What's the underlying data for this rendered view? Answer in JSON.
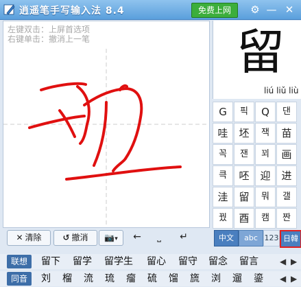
{
  "titlebar": {
    "title": "逍遥笔手写输入法 8.4",
    "online_button": "免费上网",
    "settings_icon": "gear-icon",
    "minimize_icon": "minimize-icon",
    "close_icon": "close-icon"
  },
  "pad": {
    "hint_line1": "左键双击：上屏首选项",
    "hint_line2": "右键单击：撤消上一笔",
    "stroke_color": "#e01010"
  },
  "padbar": {
    "clear_label": "清除",
    "undo_label": "撤消",
    "camera_icon": "camera-icon",
    "left_icon": "arrow-left-icon",
    "space_icon": "space-icon",
    "enter_icon": "enter-icon"
  },
  "preview": {
    "character": "留",
    "pinyin": "liú liǔ liù"
  },
  "grid_cells": [
    [
      "G",
      "픽",
      "Q",
      "댄"
    ],
    [
      "哇",
      "坯",
      "잭",
      "苗"
    ],
    [
      "꼭",
      "잰",
      "꾀",
      "画"
    ],
    [
      "큭",
      "呸",
      "迎",
      "进"
    ],
    [
      "洼",
      "留",
      "뭐",
      "갤"
    ],
    [
      "꿨",
      "酉",
      "캠",
      "짠"
    ]
  ],
  "bottom_tabs": [
    "中文",
    "abc",
    "123",
    "日韓"
  ],
  "associate": {
    "label": "联想",
    "items": [
      "留下",
      "留学",
      "留学生",
      "留心",
      "留守",
      "留念",
      "留言"
    ]
  },
  "homophone": {
    "label": "同音",
    "items": [
      "刘",
      "榴",
      "流",
      "琉",
      "瘤",
      "硫",
      "馏",
      "旒",
      "浏",
      "遛",
      "鎏"
    ]
  },
  "colors": {
    "titlebar": "#5a9fdc",
    "accent_red": "#e02020",
    "tab_blue": "#4a7fbf"
  }
}
